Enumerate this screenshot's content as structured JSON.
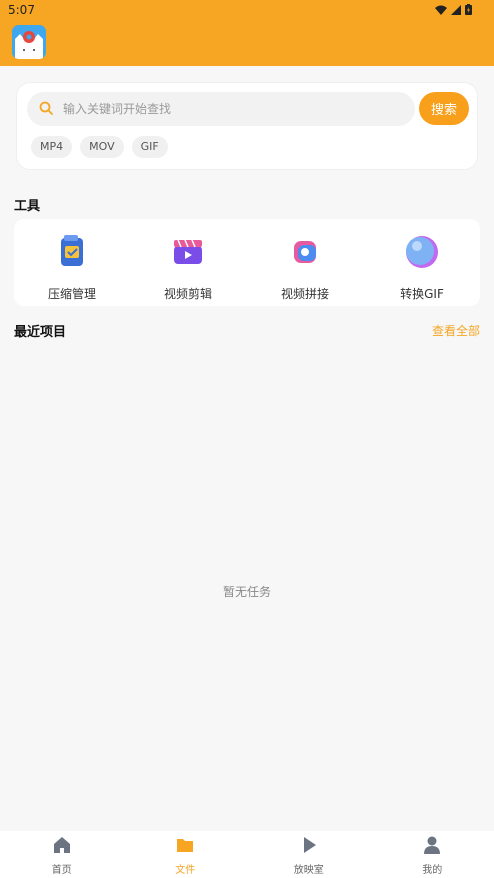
{
  "status_bar": {
    "time": "5:07"
  },
  "search": {
    "placeholder": "输入关键词开始查找",
    "button_label": "搜索"
  },
  "chips": [
    "MP4",
    "MOV",
    "GIF"
  ],
  "tools": {
    "title": "工具",
    "items": [
      {
        "label": "压缩管理",
        "icon": "compress-icon"
      },
      {
        "label": "视频剪辑",
        "icon": "video-edit-icon"
      },
      {
        "label": "视频拼接",
        "icon": "video-join-icon"
      },
      {
        "label": "转换GIF",
        "icon": "gif-convert-icon"
      }
    ]
  },
  "recent": {
    "title": "最近项目",
    "view_all": "查看全部",
    "empty_text": "暂无任务"
  },
  "bottom_nav": {
    "items": [
      {
        "label": "首页",
        "icon": "home-icon"
      },
      {
        "label": "文件",
        "icon": "folder-icon"
      },
      {
        "label": "放映室",
        "icon": "play-icon"
      },
      {
        "label": "我的",
        "icon": "user-icon"
      }
    ],
    "active_index": 1
  },
  "colors": {
    "accent": "#f6a623",
    "background": "#f7f7f7"
  }
}
